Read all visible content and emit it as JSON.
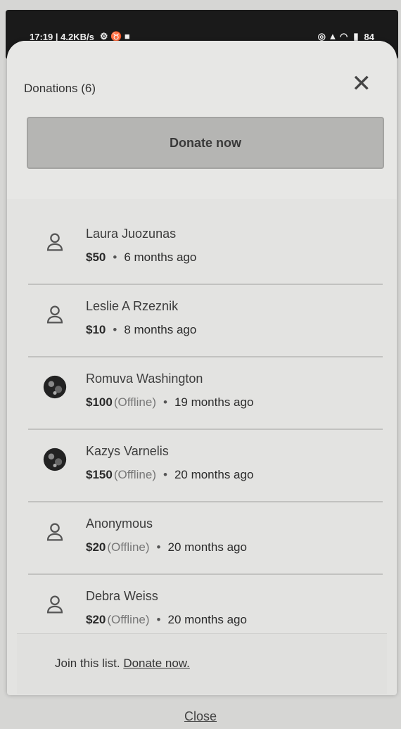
{
  "status_bar": {
    "left": "17:19 | 4.2KB/s",
    "right": "84"
  },
  "modal": {
    "title": "Donations (6)",
    "close_symbol": "✕",
    "donate_button": "Donate now"
  },
  "donations": [
    {
      "name": "Laura Juozunas",
      "amount": "$50",
      "offline": "",
      "time": "6 months ago",
      "avatar": "person-icon"
    },
    {
      "name": "Leslie A Rzeznik",
      "amount": "$10",
      "offline": "",
      "time": "8 months ago",
      "avatar": "person-icon"
    },
    {
      "name": "Romuva Washington",
      "amount": "$100",
      "offline": "(Offline)",
      "time": "19 months ago",
      "avatar": "photo"
    },
    {
      "name": "Kazys Varnelis",
      "amount": "$150",
      "offline": "(Offline)",
      "time": "20 months ago",
      "avatar": "photo"
    },
    {
      "name": "Anonymous",
      "amount": "$20",
      "offline": "(Offline)",
      "time": "20 months ago",
      "avatar": "person-icon"
    },
    {
      "name": "Debra Weiss",
      "amount": "$20",
      "offline": "(Offline)",
      "time": "20 months ago",
      "avatar": "person-icon"
    }
  ],
  "footer": {
    "text": "Join this list.",
    "link": "Donate now."
  },
  "close_link": "Close",
  "separator": "•"
}
